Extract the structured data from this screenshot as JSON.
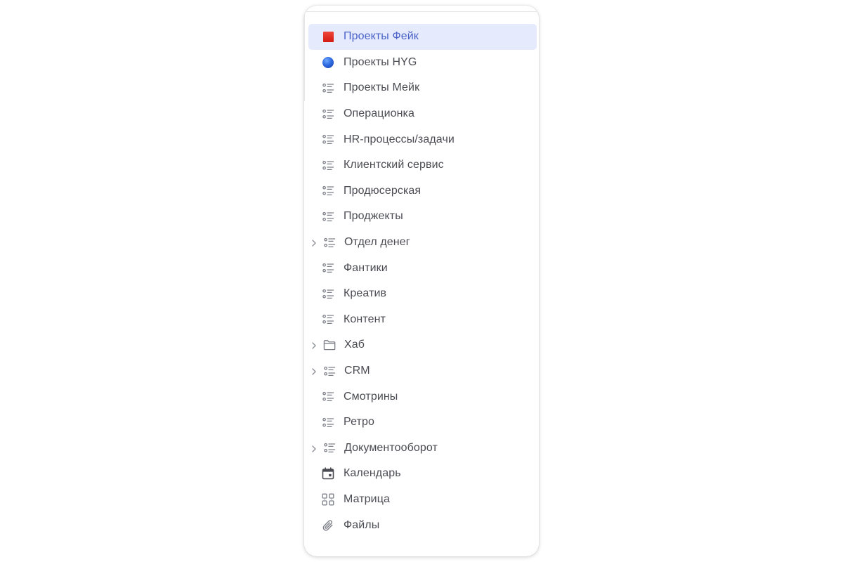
{
  "menu": {
    "items": [
      {
        "label": "Проекты Фейк",
        "icon": "red-square-icon",
        "active": true,
        "expandable": false
      },
      {
        "label": "Проекты HYG",
        "icon": "blue-circle-icon",
        "active": false,
        "expandable": false
      },
      {
        "label": "Проекты Мейк",
        "icon": "list-icon",
        "active": false,
        "expandable": false
      },
      {
        "label": "Операционка",
        "icon": "list-icon",
        "active": false,
        "expandable": false
      },
      {
        "label": "HR-процессы/задачи",
        "icon": "list-icon",
        "active": false,
        "expandable": false
      },
      {
        "label": "Клиентский сервис",
        "icon": "list-icon",
        "active": false,
        "expandable": false
      },
      {
        "label": "Продюсерская",
        "icon": "list-icon",
        "active": false,
        "expandable": false
      },
      {
        "label": "Проджекты",
        "icon": "list-icon",
        "active": false,
        "expandable": false
      },
      {
        "label": "Отдел денег",
        "icon": "list-icon",
        "active": false,
        "expandable": true
      },
      {
        "label": "Фантики",
        "icon": "list-icon",
        "active": false,
        "expandable": false
      },
      {
        "label": "Креатив",
        "icon": "list-icon",
        "active": false,
        "expandable": false
      },
      {
        "label": "Контент",
        "icon": "list-icon",
        "active": false,
        "expandable": false
      },
      {
        "label": "Хаб",
        "icon": "folder-icon",
        "active": false,
        "expandable": true
      },
      {
        "label": "CRM",
        "icon": "list-icon",
        "active": false,
        "expandable": true
      },
      {
        "label": "Смотрины",
        "icon": "list-icon",
        "active": false,
        "expandable": false
      },
      {
        "label": "Ретро",
        "icon": "list-icon",
        "active": false,
        "expandable": false
      },
      {
        "label": "Документооборот",
        "icon": "list-icon",
        "active": false,
        "expandable": true
      },
      {
        "label": "Календарь",
        "icon": "calendar-icon",
        "active": false,
        "expandable": false
      },
      {
        "label": "Матрица",
        "icon": "matrix-icon",
        "active": false,
        "expandable": false
      },
      {
        "label": "Файлы",
        "icon": "paperclip-icon",
        "active": false,
        "expandable": false
      }
    ]
  },
  "colors": {
    "active_background": "#e5eafc",
    "active_text": "#4a62c8",
    "text": "#4b4c53",
    "icon": "#7d8089"
  }
}
